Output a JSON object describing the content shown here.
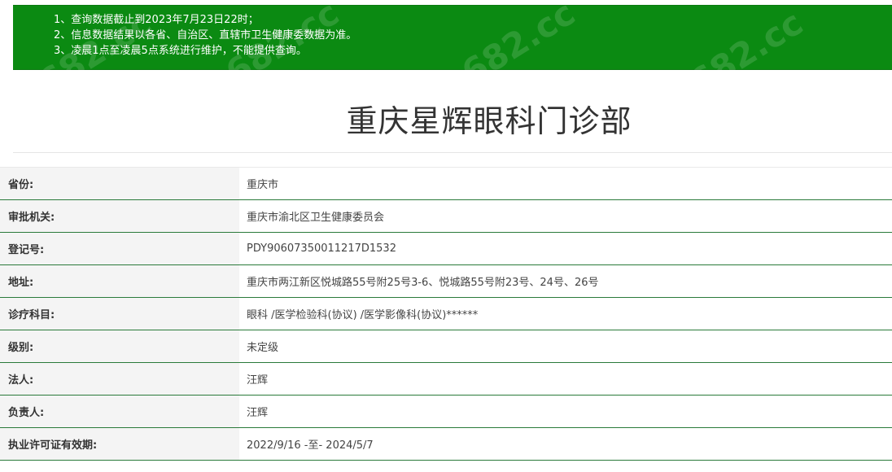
{
  "notice": {
    "lines": [
      "1、查询数据截止到2023年7月23日22时；",
      "2、信息数据结果以各省、自治区、直辖市卫生健康委数据为准。",
      "3、凌晨1点至凌晨5点系统进行维护，不能提供查询。"
    ]
  },
  "page": {
    "title": "重庆星辉眼科门诊部"
  },
  "watermark": {
    "text": "682.cc"
  },
  "info": {
    "rows": [
      {
        "label": "省份:",
        "value": "重庆市"
      },
      {
        "label": "审批机关:",
        "value": "重庆市渝北区卫生健康委员会"
      },
      {
        "label": "登记号:",
        "value": "PDY90607350011217D1532"
      },
      {
        "label": "地址:",
        "value": "重庆市两江新区悦城路55号附25号3-6、悦城路55号附23号、24号、26号"
      },
      {
        "label": "诊疗科目:",
        "value": "眼科 /医学检验科(协议) /医学影像科(协议)******"
      },
      {
        "label": "级别:",
        "value": "未定级"
      },
      {
        "label": "法人:",
        "value": "汪辉"
      },
      {
        "label": "负责人:",
        "value": "汪辉"
      },
      {
        "label": "执业许可证有效期:",
        "value": "2022/9/16 -至- 2024/5/7"
      }
    ]
  },
  "colors": {
    "notice_bg": "#0b8a12",
    "row_border": "#2a7a3a",
    "label_bg": "#f4f4f4"
  }
}
